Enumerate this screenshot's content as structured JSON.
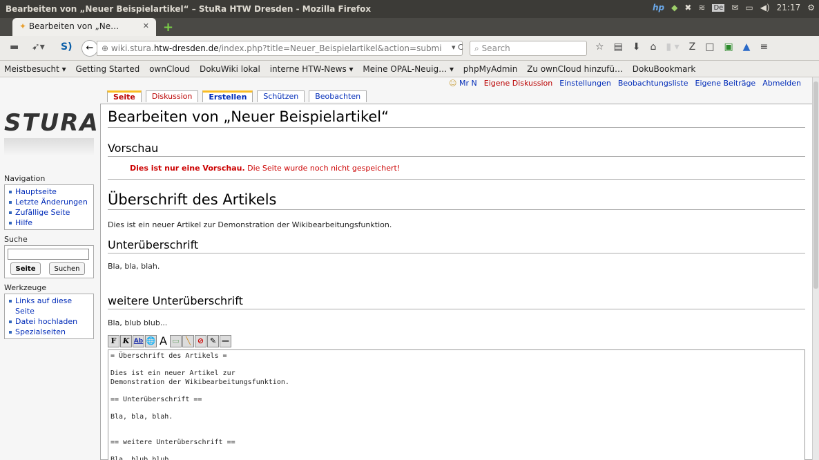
{
  "window": {
    "title": "Bearbeiten von „Neuer Beispielartikel“ – StuRa HTW Dresden - Mozilla Firefox",
    "tray_lang": "De",
    "clock": "21:17"
  },
  "tab": {
    "label": "Bearbeiten von „Ne…"
  },
  "nav": {
    "url_prefix": "wiki.stura.",
    "url_host": "htw-dresden.de",
    "url_rest": "/index.php?title=Neuer_Beispielartikel&action=submi",
    "search_placeholder": "Search"
  },
  "bookmarks": [
    "Meistbesucht ▾",
    "Getting Started",
    "ownCloud",
    "DokuWiki lokal",
    "interne HTW-News ▾",
    "Meine OPAL-Neuig… ▾",
    "phpMyAdmin",
    "Zu ownCloud hinzufü…",
    "DokuBookmark"
  ],
  "user_nav": {
    "user": "Mr N",
    "items": [
      "Eigene Diskussion",
      "Einstellungen",
      "Beobachtungsliste",
      "Eigene Beiträge",
      "Abmelden"
    ]
  },
  "page_tabs": [
    "Seite",
    "Diskussion",
    "Erstellen",
    "Schützen",
    "Beobachten"
  ],
  "logo": "STURA",
  "sidebar": {
    "nav_heading": "Navigation",
    "nav_items": [
      "Hauptseite",
      "Letzte Änderungen",
      "Zufällige Seite",
      "Hilfe"
    ],
    "search_heading": "Suche",
    "search_btn": "Seite",
    "fulltext_btn": "Suchen",
    "tools_heading": "Werkzeuge",
    "tools_items": [
      "Links auf diese Seite",
      "Datei hochladen",
      "Spezialseiten"
    ]
  },
  "main": {
    "title": "Bearbeiten von „Neuer Beispielartikel“",
    "preview_heading": "Vorschau",
    "preview_bold": "Dies ist nur eine Vorschau.",
    "preview_rest": " Die Seite wurde noch nicht gespeichert!",
    "h1": "Überschrift des Artikels",
    "p1": "Dies ist ein neuer Artikel zur Demonstration der Wikibearbeitungsfunktion.",
    "h2": "Unterüberschrift",
    "p2": "Bla, bla, blah.",
    "h3": "weitere Unterüberschrift",
    "p3": "Bla, blub blub...",
    "toolbar": [
      "F",
      "K",
      "Ab",
      "🌐",
      "A",
      "▭",
      "╲",
      "⊘",
      "✎",
      "—"
    ],
    "editor_text": "= Überschrift des Artikels =\n\nDies ist ein neuer Artikel zur\nDemonstration der Wikibearbeitungsfunktion.\n\n== Unterüberschrift ==\n\nBla, bla, blah.\n\n\n== weitere Unterüberschrift ==\n\nBla, blub blub..."
  }
}
